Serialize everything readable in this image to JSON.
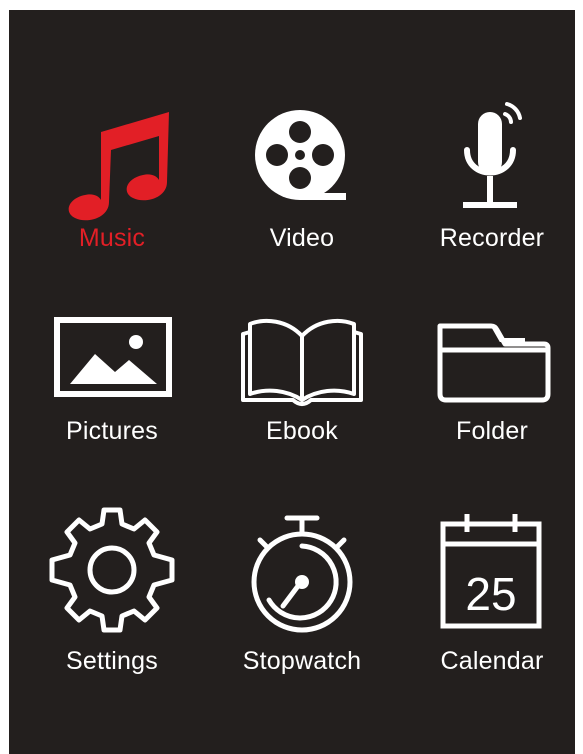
{
  "colors": {
    "background": "#231f1e",
    "foreground": "#ffffff",
    "accent": "#e21f26"
  },
  "menu": {
    "selected": "music",
    "items": [
      {
        "id": "music",
        "label": "Music",
        "icon": "music-note-icon"
      },
      {
        "id": "video",
        "label": "Video",
        "icon": "film-reel-icon"
      },
      {
        "id": "recorder",
        "label": "Recorder",
        "icon": "microphone-icon"
      },
      {
        "id": "pictures",
        "label": "Pictures",
        "icon": "picture-icon"
      },
      {
        "id": "ebook",
        "label": "Ebook",
        "icon": "book-icon"
      },
      {
        "id": "folder",
        "label": "Folder",
        "icon": "folder-icon"
      },
      {
        "id": "settings",
        "label": "Settings",
        "icon": "gear-icon"
      },
      {
        "id": "stopwatch",
        "label": "Stopwatch",
        "icon": "stopwatch-icon"
      },
      {
        "id": "calendar",
        "label": "Calendar",
        "icon": "calendar-icon",
        "day": "25"
      }
    ]
  }
}
